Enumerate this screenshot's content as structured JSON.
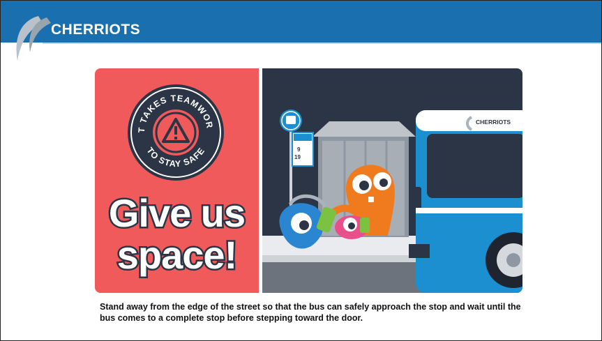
{
  "header": {
    "brand": "CHERRIOTS"
  },
  "poster": {
    "badge_top_text": "IT TAKES TEAMWORK",
    "badge_bottom_text": "TO STAY SAFE",
    "headline_line1": "Give us",
    "headline_line2": "space!",
    "bus_brand": "CHERRIOTS",
    "stop_sign_routes": [
      "9",
      "19"
    ]
  },
  "caption": "Stand away from the edge of the street so that the bus can safely approach the stop and wait until the bus comes to a complete stop before stepping toward the door.",
  "colors": {
    "header_blue": "#1a6fae",
    "poster_red": "#f05a5b",
    "navy": "#2b3545",
    "bus_blue": "#1b8fd0",
    "orange_monster": "#f07a1e",
    "blue_monster": "#2a86d0",
    "pink_monster": "#e94f8b"
  }
}
